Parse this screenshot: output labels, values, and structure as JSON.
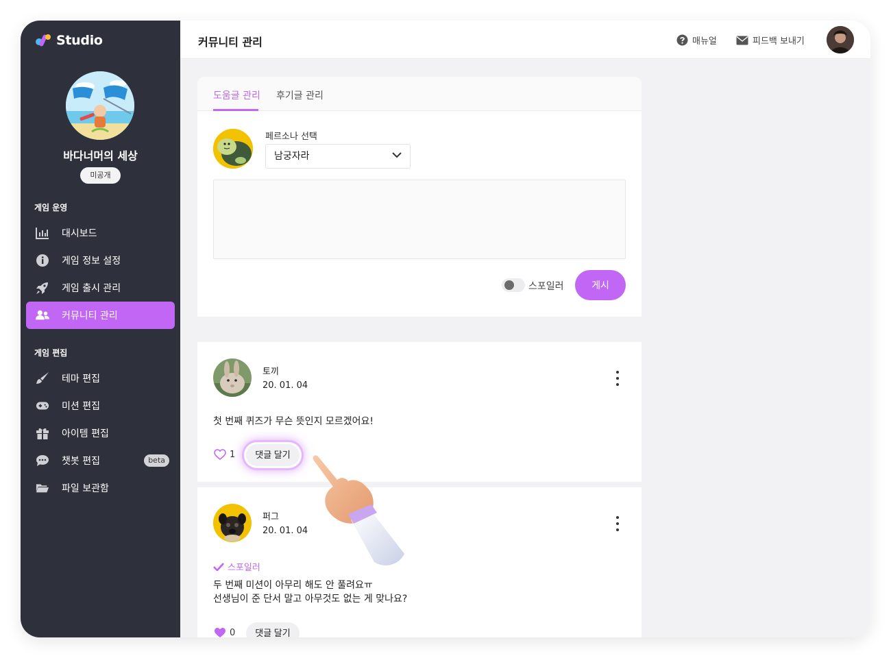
{
  "app": {
    "logo_text": "Studio"
  },
  "sidebar": {
    "game_name": "바다너머의 세상",
    "visibility_badge": "미공개",
    "sections": [
      {
        "title": "게임 운영",
        "items": [
          {
            "label": "대시보드",
            "icon": "bar-chart-icon"
          },
          {
            "label": "게임 정보 설정",
            "icon": "info-icon"
          },
          {
            "label": "게임 출시 관리",
            "icon": "rocket-icon"
          },
          {
            "label": "커뮤니티 관리",
            "icon": "users-icon",
            "active": true
          }
        ]
      },
      {
        "title": "게임 편집",
        "items": [
          {
            "label": "테마 편집",
            "icon": "brush-icon"
          },
          {
            "label": "미션 편집",
            "icon": "gamepad-icon"
          },
          {
            "label": "아이템 편집",
            "icon": "gift-icon"
          },
          {
            "label": "챗봇 편집",
            "icon": "chat-icon",
            "badge": "beta"
          },
          {
            "label": "파일 보관함",
            "icon": "folder-icon"
          }
        ]
      }
    ]
  },
  "topbar": {
    "title": "커뮤니티 관리",
    "manual_label": "매뉴얼",
    "feedback_label": "피드백 보내기"
  },
  "tabs": [
    {
      "label": "도움글 관리",
      "active": true
    },
    {
      "label": "후기글 관리",
      "active": false
    }
  ],
  "composer": {
    "persona_label": "페르소나 선택",
    "persona_selected": "남궁자라",
    "text_value": "",
    "spoiler_label": "스포일러",
    "spoiler_on": false,
    "post_button": "게시"
  },
  "posts": [
    {
      "author": "토끼",
      "date": "20. 01. 04",
      "spoiler": false,
      "lines": [
        "첫 번째 퀴즈가 무슨 뜻인지 모르겠어요!"
      ],
      "likes": "1",
      "liked": false,
      "reply_label": "댓글 달기"
    },
    {
      "author": "퍼그",
      "date": "20. 01. 04",
      "spoiler": true,
      "spoiler_label": "스포일러",
      "lines": [
        "두 번째 미션이 아무리 해도 안 풀려요ㅠ",
        "선생님이 준 단서 말고 아무것도 없는 게 맞나요?"
      ],
      "likes": "0",
      "liked": true,
      "reply_label": "댓글 달기"
    }
  ],
  "colors": {
    "accent": "#c266f5",
    "sidebar_bg": "#2e303b",
    "page_bg": "#f2f2f4"
  }
}
